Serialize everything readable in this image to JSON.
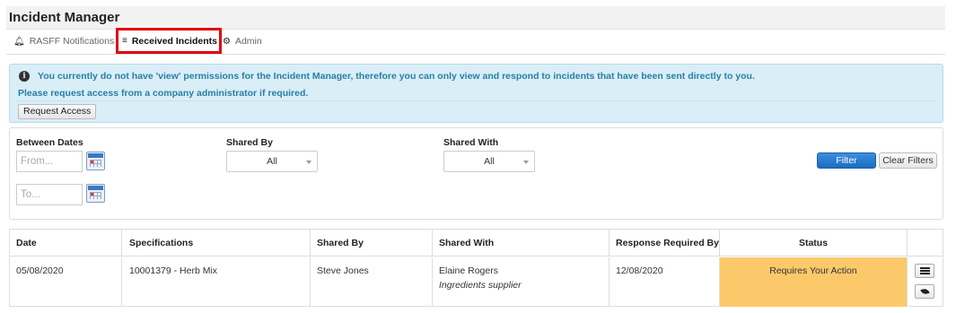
{
  "app": {
    "title": "Incident Manager"
  },
  "tabs": [
    {
      "label": "RASFF Notifications",
      "icon": "bell-icon"
    },
    {
      "label": "Received Incidents",
      "icon": "list-icon",
      "active": true
    },
    {
      "label": "Admin",
      "icon": "gear-icon"
    }
  ],
  "alert": {
    "line1": "You currently do not have 'view' permissions for the Incident Manager, therefore you can only view and respond to incidents that have been sent directly to you.",
    "line2": "Please request access from a company administrator if required.",
    "button": "Request Access",
    "color": "#2a7fa5"
  },
  "filters": {
    "between_dates_label": "Between Dates",
    "from_placeholder": "From...",
    "to_placeholder": "To...",
    "shared_by_label": "Shared By",
    "shared_by_value": "All",
    "shared_with_label": "Shared With",
    "shared_with_value": "All",
    "filter_button": "Filter",
    "clear_button": "Clear Filters"
  },
  "table": {
    "headers": [
      "Date",
      "Specifications",
      "Shared By",
      "Shared With",
      "Response Required By",
      "Status"
    ],
    "rows": [
      {
        "date": "05/08/2020",
        "specifications": "10001379 - Herb Mix",
        "shared_by": "Steve Jones",
        "shared_with": "Elaine Rogers",
        "shared_with_role": "Ingredients supplier",
        "response_required_by": "12/08/2020",
        "status": "Requires Your Action",
        "status_color": "#fcc96a"
      }
    ]
  },
  "colors": {
    "highlight_border": "#e3000f",
    "filter_button": "#1c6cbf"
  }
}
